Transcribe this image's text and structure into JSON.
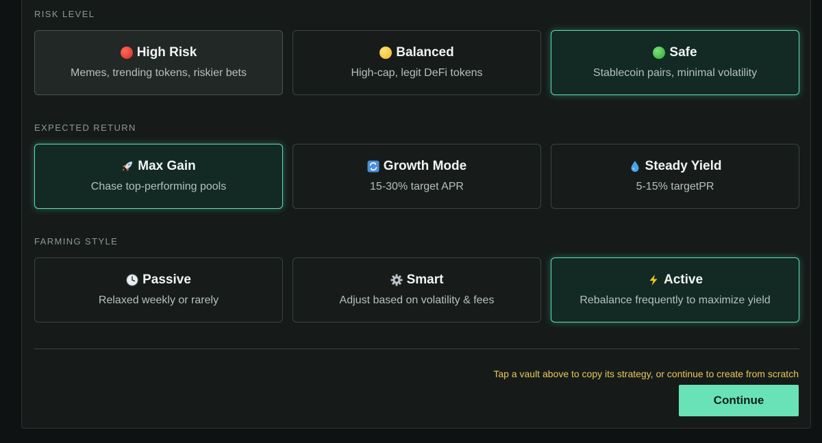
{
  "colors": {
    "accent": "#69e2b8",
    "selected_border": "#5ee3b5",
    "hint": "#e9c75a",
    "background": "#161b1a"
  },
  "sections": [
    {
      "label": "RISK LEVEL",
      "options": [
        {
          "icon": "red-circle-icon",
          "title": "High Risk",
          "subtitle": "Memes, trending tokens, riskier bets",
          "state": "muted"
        },
        {
          "icon": "yellow-circle-icon",
          "title": "Balanced",
          "subtitle": "High-cap, legit DeFi tokens",
          "state": "default"
        },
        {
          "icon": "green-circle-icon",
          "title": "Safe",
          "subtitle": "Stablecoin pairs, minimal volatility",
          "state": "selected"
        }
      ]
    },
    {
      "label": "EXPECTED RETURN",
      "options": [
        {
          "icon": "rocket-icon",
          "title": "Max Gain",
          "subtitle": "Chase top-performing pools",
          "state": "selected"
        },
        {
          "icon": "refresh-icon",
          "title": "Growth Mode",
          "subtitle": "15-30% target APR",
          "state": "default"
        },
        {
          "icon": "droplet-icon",
          "title": "Steady Yield",
          "subtitle": "5-15% targetPR",
          "state": "default"
        }
      ]
    },
    {
      "label": "FARMING STYLE",
      "options": [
        {
          "icon": "clock-icon",
          "title": "Passive",
          "subtitle": "Relaxed weekly or rarely",
          "state": "default"
        },
        {
          "icon": "gear-icon",
          "title": "Smart",
          "subtitle": "Adjust based on volatility & fees",
          "state": "default"
        },
        {
          "icon": "lightning-icon",
          "title": "Active",
          "subtitle": "Rebalance frequently to maximize yield",
          "state": "selected"
        }
      ]
    }
  ],
  "footer": {
    "hint": "Tap a vault above to copy its strategy, or continue to create from scratch",
    "continue_label": "Continue"
  }
}
